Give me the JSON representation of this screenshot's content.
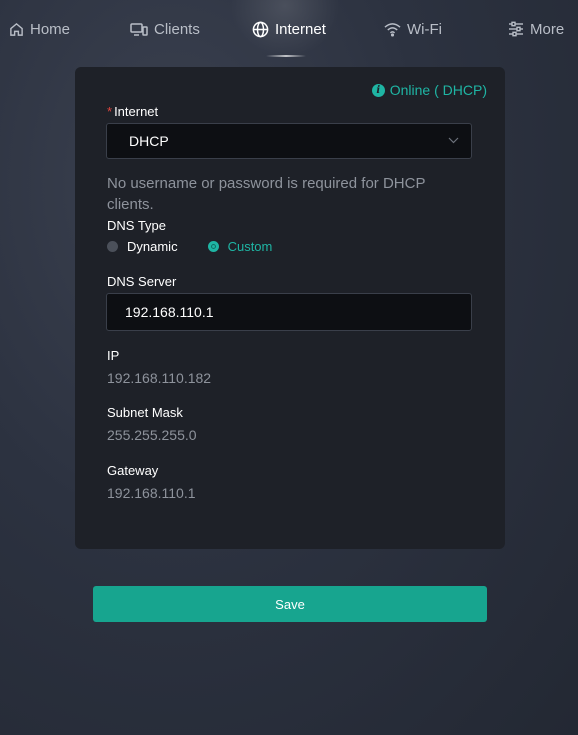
{
  "nav": {
    "items": [
      {
        "label": "Home",
        "icon": "home-icon"
      },
      {
        "label": "Clients",
        "icon": "clients-icon"
      },
      {
        "label": "Internet",
        "icon": "globe-icon",
        "active": true
      },
      {
        "label": "Wi-Fi",
        "icon": "wifi-icon"
      },
      {
        "label": "More",
        "icon": "sliders-icon"
      }
    ]
  },
  "status": {
    "text": "Online ( DHCP)",
    "icon": "info-icon",
    "color": "#1fb5a4"
  },
  "internet": {
    "label": "Internet",
    "value": "DHCP"
  },
  "hint": "No username or password is required for DHCP clients.",
  "dns_type": {
    "label": "DNS Type",
    "options": [
      "Dynamic",
      "Custom"
    ],
    "selected": "Custom"
  },
  "dns_server": {
    "label": "DNS Server",
    "value": "192.168.110.1"
  },
  "ip": {
    "label": "IP",
    "value": "192.168.110.182"
  },
  "subnet": {
    "label": "Subnet Mask",
    "value": "255.255.255.0"
  },
  "gateway": {
    "label": "Gateway",
    "value": "192.168.110.1"
  },
  "save_label": "Save",
  "colors": {
    "accent": "#1fb5a4",
    "button": "#17a58f",
    "required": "#e0463e"
  }
}
